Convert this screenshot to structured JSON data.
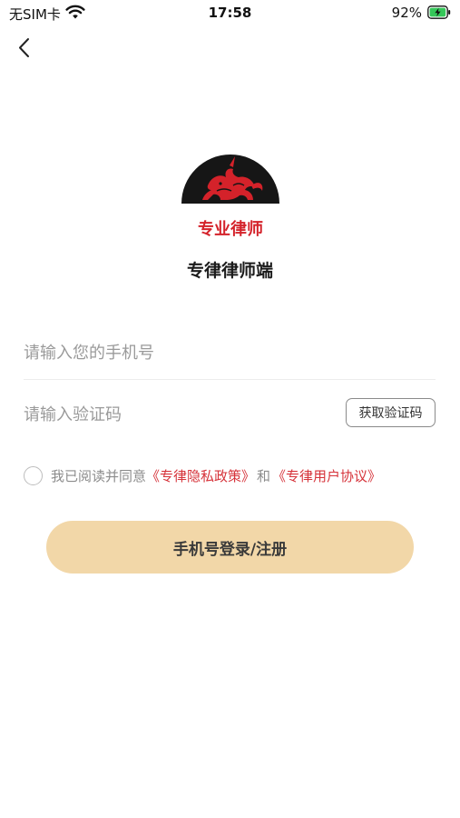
{
  "status_bar": {
    "carrier": "无SIM卡",
    "time": "17:58",
    "battery": "92%",
    "wifi_icon": "wifi-icon",
    "battery_icon": "battery-charging-icon"
  },
  "nav": {
    "back_icon": "chevron-left-icon"
  },
  "logo": {
    "text": "专业律师",
    "colors": {
      "circle": "#161616",
      "emblem": "#d4222a",
      "text": "#d4222a"
    }
  },
  "app_name": "专律律师端",
  "form": {
    "phone_placeholder": "请输入您的手机号",
    "code_placeholder": "请输入验证码",
    "get_code_label": "获取验证码"
  },
  "agreement": {
    "prefix": "我已阅读并同意",
    "privacy_link": "《专律隐私政策》",
    "connector": "和",
    "terms_link": "《专律用户协议》",
    "checked": false
  },
  "login_button": "手机号登录/注册",
  "colors": {
    "accent_button": "#f2d7a8",
    "link": "#d6333a",
    "placeholder": "#9a9a9a"
  }
}
